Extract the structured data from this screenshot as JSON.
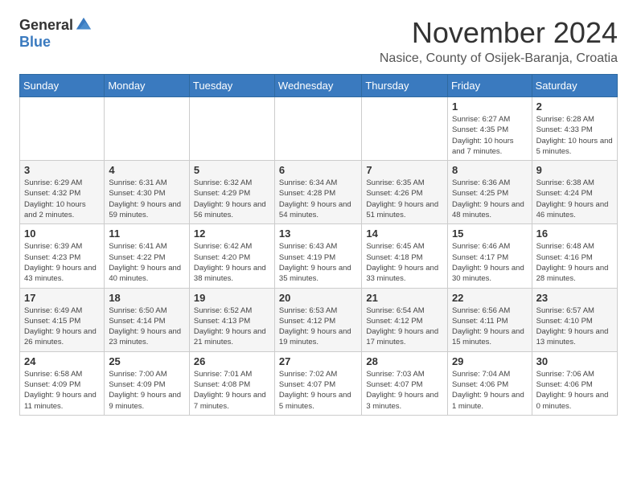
{
  "logo": {
    "general": "General",
    "blue": "Blue"
  },
  "title": "November 2024",
  "location": "Nasice, County of Osijek-Baranja, Croatia",
  "days_header": [
    "Sunday",
    "Monday",
    "Tuesday",
    "Wednesday",
    "Thursday",
    "Friday",
    "Saturday"
  ],
  "weeks": [
    [
      {
        "day": "",
        "info": ""
      },
      {
        "day": "",
        "info": ""
      },
      {
        "day": "",
        "info": ""
      },
      {
        "day": "",
        "info": ""
      },
      {
        "day": "",
        "info": ""
      },
      {
        "day": "1",
        "info": "Sunrise: 6:27 AM\nSunset: 4:35 PM\nDaylight: 10 hours and 7 minutes."
      },
      {
        "day": "2",
        "info": "Sunrise: 6:28 AM\nSunset: 4:33 PM\nDaylight: 10 hours and 5 minutes."
      }
    ],
    [
      {
        "day": "3",
        "info": "Sunrise: 6:29 AM\nSunset: 4:32 PM\nDaylight: 10 hours and 2 minutes."
      },
      {
        "day": "4",
        "info": "Sunrise: 6:31 AM\nSunset: 4:30 PM\nDaylight: 9 hours and 59 minutes."
      },
      {
        "day": "5",
        "info": "Sunrise: 6:32 AM\nSunset: 4:29 PM\nDaylight: 9 hours and 56 minutes."
      },
      {
        "day": "6",
        "info": "Sunrise: 6:34 AM\nSunset: 4:28 PM\nDaylight: 9 hours and 54 minutes."
      },
      {
        "day": "7",
        "info": "Sunrise: 6:35 AM\nSunset: 4:26 PM\nDaylight: 9 hours and 51 minutes."
      },
      {
        "day": "8",
        "info": "Sunrise: 6:36 AM\nSunset: 4:25 PM\nDaylight: 9 hours and 48 minutes."
      },
      {
        "day": "9",
        "info": "Sunrise: 6:38 AM\nSunset: 4:24 PM\nDaylight: 9 hours and 46 minutes."
      }
    ],
    [
      {
        "day": "10",
        "info": "Sunrise: 6:39 AM\nSunset: 4:23 PM\nDaylight: 9 hours and 43 minutes."
      },
      {
        "day": "11",
        "info": "Sunrise: 6:41 AM\nSunset: 4:22 PM\nDaylight: 9 hours and 40 minutes."
      },
      {
        "day": "12",
        "info": "Sunrise: 6:42 AM\nSunset: 4:20 PM\nDaylight: 9 hours and 38 minutes."
      },
      {
        "day": "13",
        "info": "Sunrise: 6:43 AM\nSunset: 4:19 PM\nDaylight: 9 hours and 35 minutes."
      },
      {
        "day": "14",
        "info": "Sunrise: 6:45 AM\nSunset: 4:18 PM\nDaylight: 9 hours and 33 minutes."
      },
      {
        "day": "15",
        "info": "Sunrise: 6:46 AM\nSunset: 4:17 PM\nDaylight: 9 hours and 30 minutes."
      },
      {
        "day": "16",
        "info": "Sunrise: 6:48 AM\nSunset: 4:16 PM\nDaylight: 9 hours and 28 minutes."
      }
    ],
    [
      {
        "day": "17",
        "info": "Sunrise: 6:49 AM\nSunset: 4:15 PM\nDaylight: 9 hours and 26 minutes."
      },
      {
        "day": "18",
        "info": "Sunrise: 6:50 AM\nSunset: 4:14 PM\nDaylight: 9 hours and 23 minutes."
      },
      {
        "day": "19",
        "info": "Sunrise: 6:52 AM\nSunset: 4:13 PM\nDaylight: 9 hours and 21 minutes."
      },
      {
        "day": "20",
        "info": "Sunrise: 6:53 AM\nSunset: 4:12 PM\nDaylight: 9 hours and 19 minutes."
      },
      {
        "day": "21",
        "info": "Sunrise: 6:54 AM\nSunset: 4:12 PM\nDaylight: 9 hours and 17 minutes."
      },
      {
        "day": "22",
        "info": "Sunrise: 6:56 AM\nSunset: 4:11 PM\nDaylight: 9 hours and 15 minutes."
      },
      {
        "day": "23",
        "info": "Sunrise: 6:57 AM\nSunset: 4:10 PM\nDaylight: 9 hours and 13 minutes."
      }
    ],
    [
      {
        "day": "24",
        "info": "Sunrise: 6:58 AM\nSunset: 4:09 PM\nDaylight: 9 hours and 11 minutes."
      },
      {
        "day": "25",
        "info": "Sunrise: 7:00 AM\nSunset: 4:09 PM\nDaylight: 9 hours and 9 minutes."
      },
      {
        "day": "26",
        "info": "Sunrise: 7:01 AM\nSunset: 4:08 PM\nDaylight: 9 hours and 7 minutes."
      },
      {
        "day": "27",
        "info": "Sunrise: 7:02 AM\nSunset: 4:07 PM\nDaylight: 9 hours and 5 minutes."
      },
      {
        "day": "28",
        "info": "Sunrise: 7:03 AM\nSunset: 4:07 PM\nDaylight: 9 hours and 3 minutes."
      },
      {
        "day": "29",
        "info": "Sunrise: 7:04 AM\nSunset: 4:06 PM\nDaylight: 9 hours and 1 minute."
      },
      {
        "day": "30",
        "info": "Sunrise: 7:06 AM\nSunset: 4:06 PM\nDaylight: 9 hours and 0 minutes."
      }
    ]
  ]
}
